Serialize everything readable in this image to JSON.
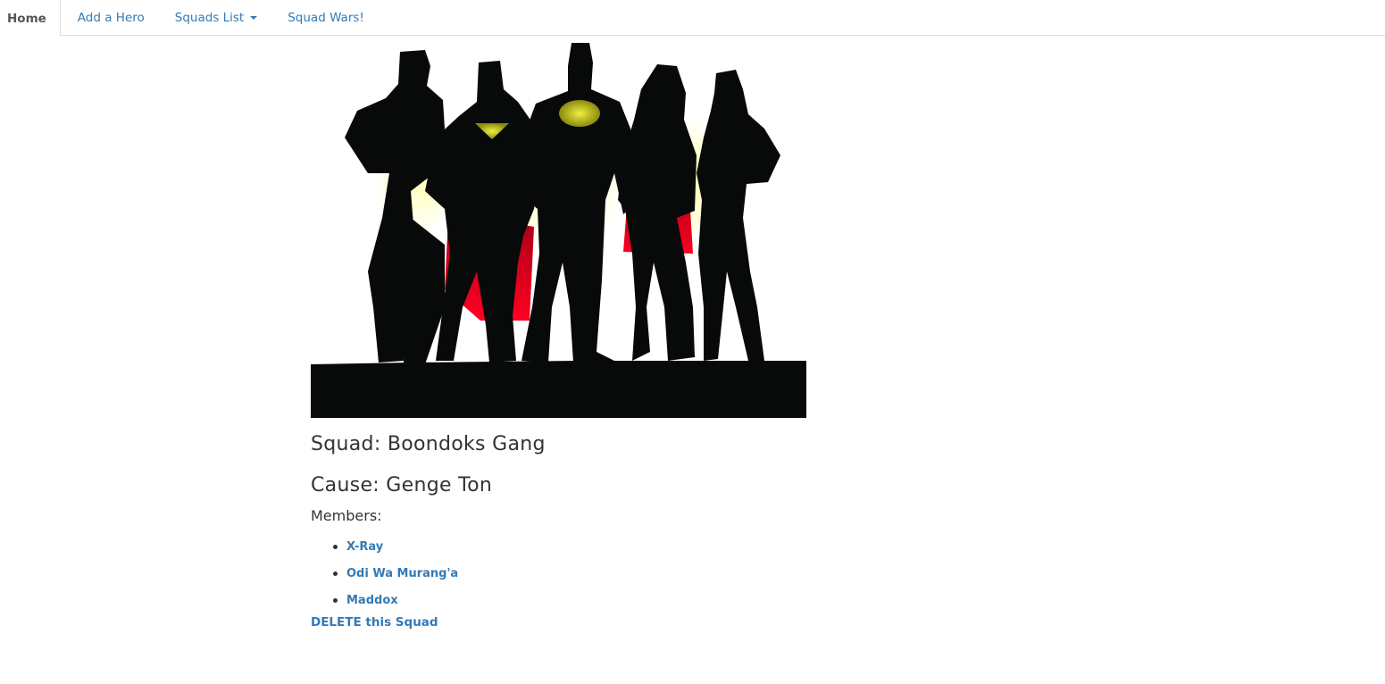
{
  "nav": {
    "items": [
      {
        "label": "Home",
        "active": true
      },
      {
        "label": "Add a Hero"
      },
      {
        "label": "Squads List",
        "dropdown": true
      },
      {
        "label": "Squad Wars!"
      }
    ]
  },
  "main": {
    "image_alt": "superhero silhouettes",
    "squad_title": "Squad: Boondoks Gang",
    "cause_title": "Cause: Genge Ton",
    "members_label": "Members:",
    "members": [
      "X-Ray",
      "Odi Wa Murang'a",
      "Maddox"
    ],
    "delete_label": "DELETE this Squad"
  },
  "colors": {
    "link": "#337ab7",
    "text": "#333333",
    "cape_red": "#c8001e",
    "emblem_yellow": "#d8d820"
  }
}
